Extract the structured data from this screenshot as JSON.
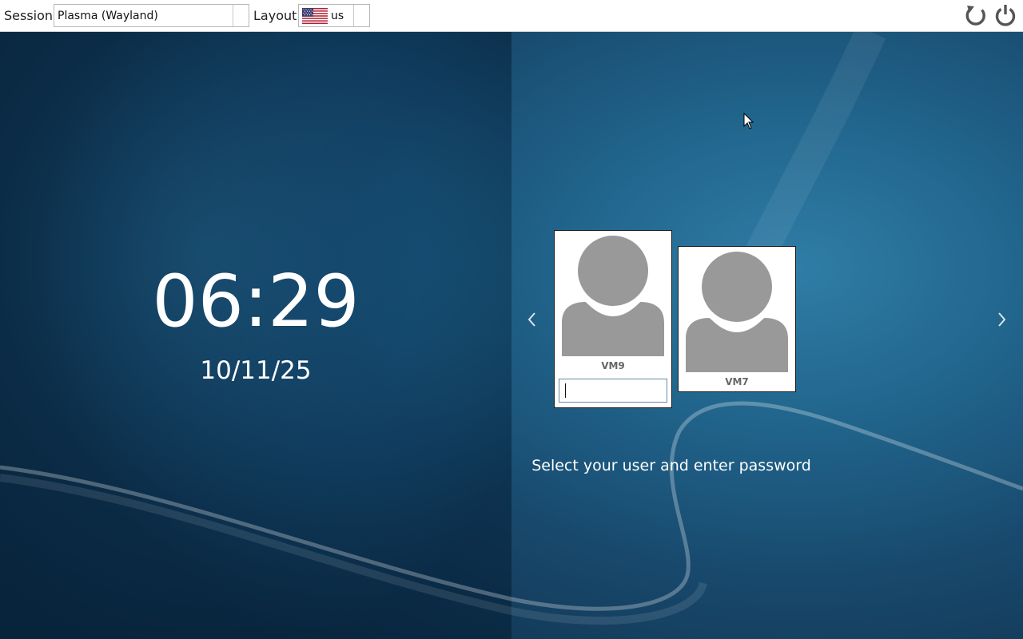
{
  "topbar": {
    "session_label": "Session",
    "session_value": "Plasma (Wayland)",
    "layout_label": "Layout",
    "layout_value": "us",
    "layout_flag": "us-flag-icon",
    "reboot_icon": "reboot-icon",
    "shutdown_icon": "power-icon"
  },
  "clock": {
    "time": "06:29",
    "date": "10/11/25"
  },
  "users": [
    {
      "name": "VM9",
      "selected": true,
      "password": ""
    },
    {
      "name": "VM7",
      "selected": false
    }
  ],
  "hint": "Select your user and enter password",
  "colors": {
    "background": "#1c628a",
    "topbar": "#ffffff",
    "avatar": "#999999",
    "text": "#ffffff"
  }
}
